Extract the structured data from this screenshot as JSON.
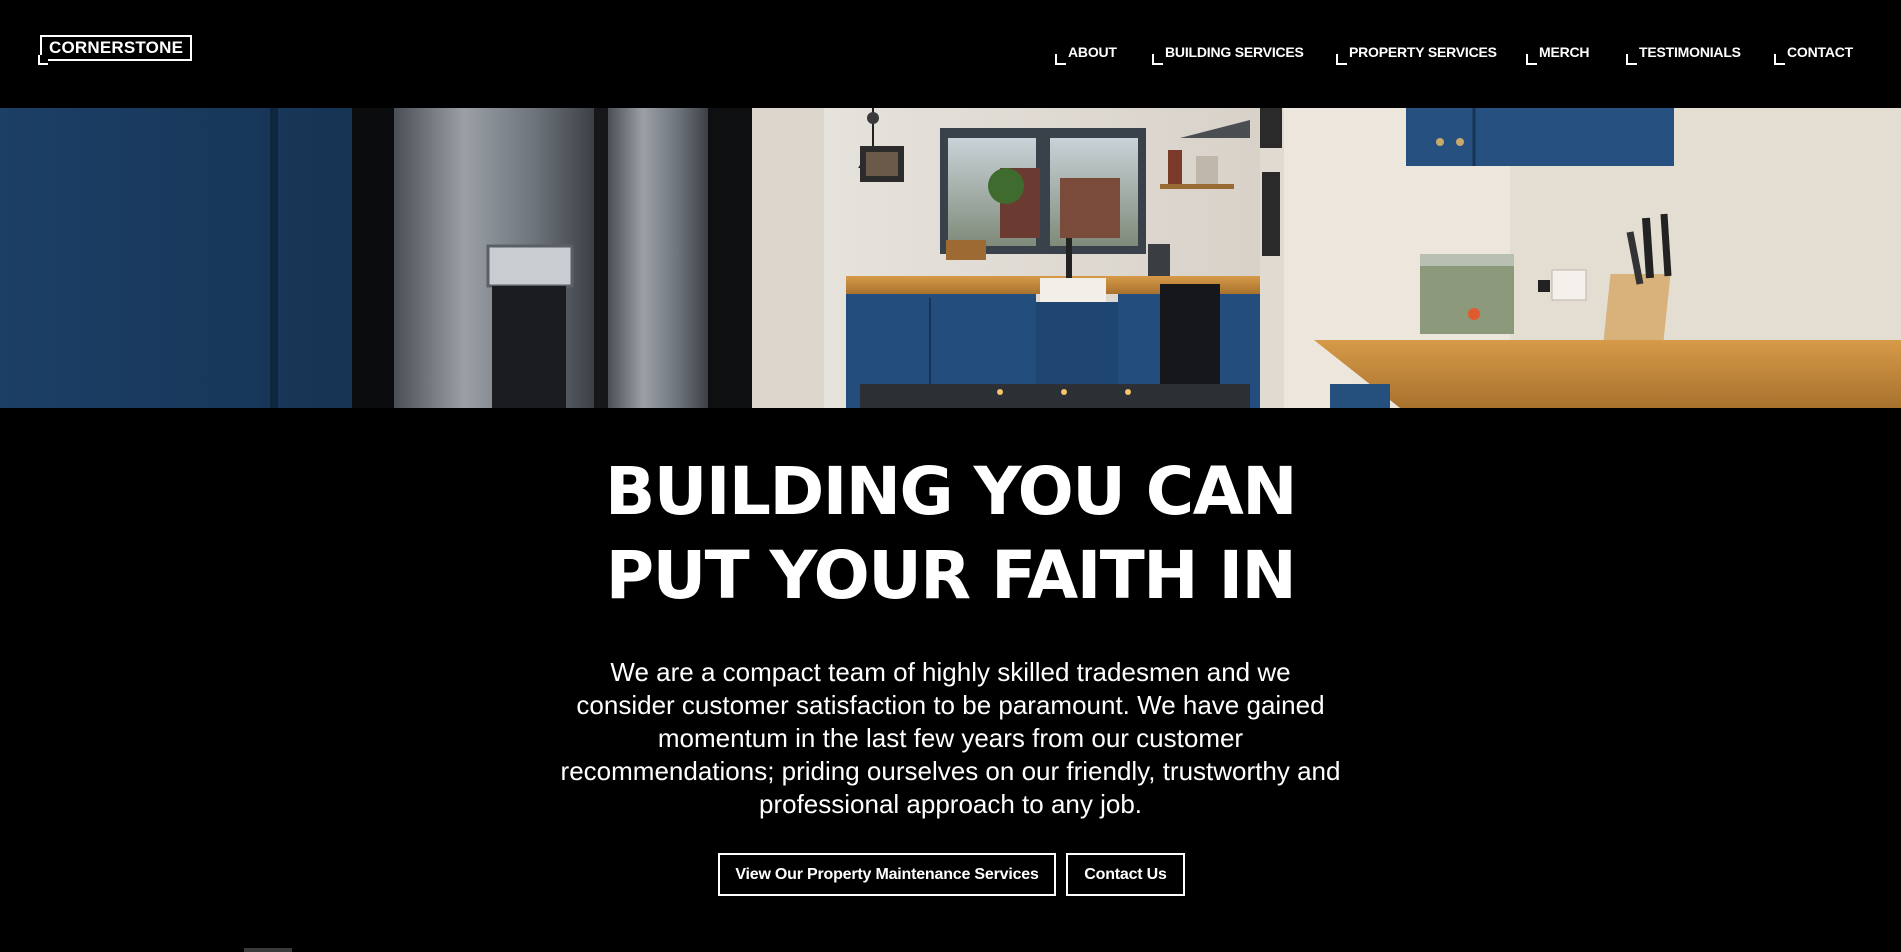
{
  "header": {
    "logo_text": "CORNERSTONE",
    "nav": [
      {
        "label": "ABOUT"
      },
      {
        "label": "BUILDING SERVICES"
      },
      {
        "label": "PROPERTY SERVICES"
      },
      {
        "label": "MERCH"
      },
      {
        "label": "TESTIMONIALS"
      },
      {
        "label": "CONTACT"
      }
    ]
  },
  "hero": {
    "headline_line1": "BUILDING YOU CAN",
    "headline_line2": "PUT YOUR FAITH IN",
    "intro": "We are a compact team of highly skilled tradesmen and we consider customer satisfaction to be paramount. We have gained momentum in the last few years from our customer recommendations; priding ourselves on our friendly, trustworthy and professional approach to any job."
  },
  "buttons": {
    "services_label": "View Our Property Maintenance Services",
    "contact_label": "Contact Us"
  },
  "colors": {
    "background": "#000000",
    "text": "#ffffff",
    "cabinet_blue": "#1f4a7a",
    "worktop_wood": "#c08a3e"
  }
}
